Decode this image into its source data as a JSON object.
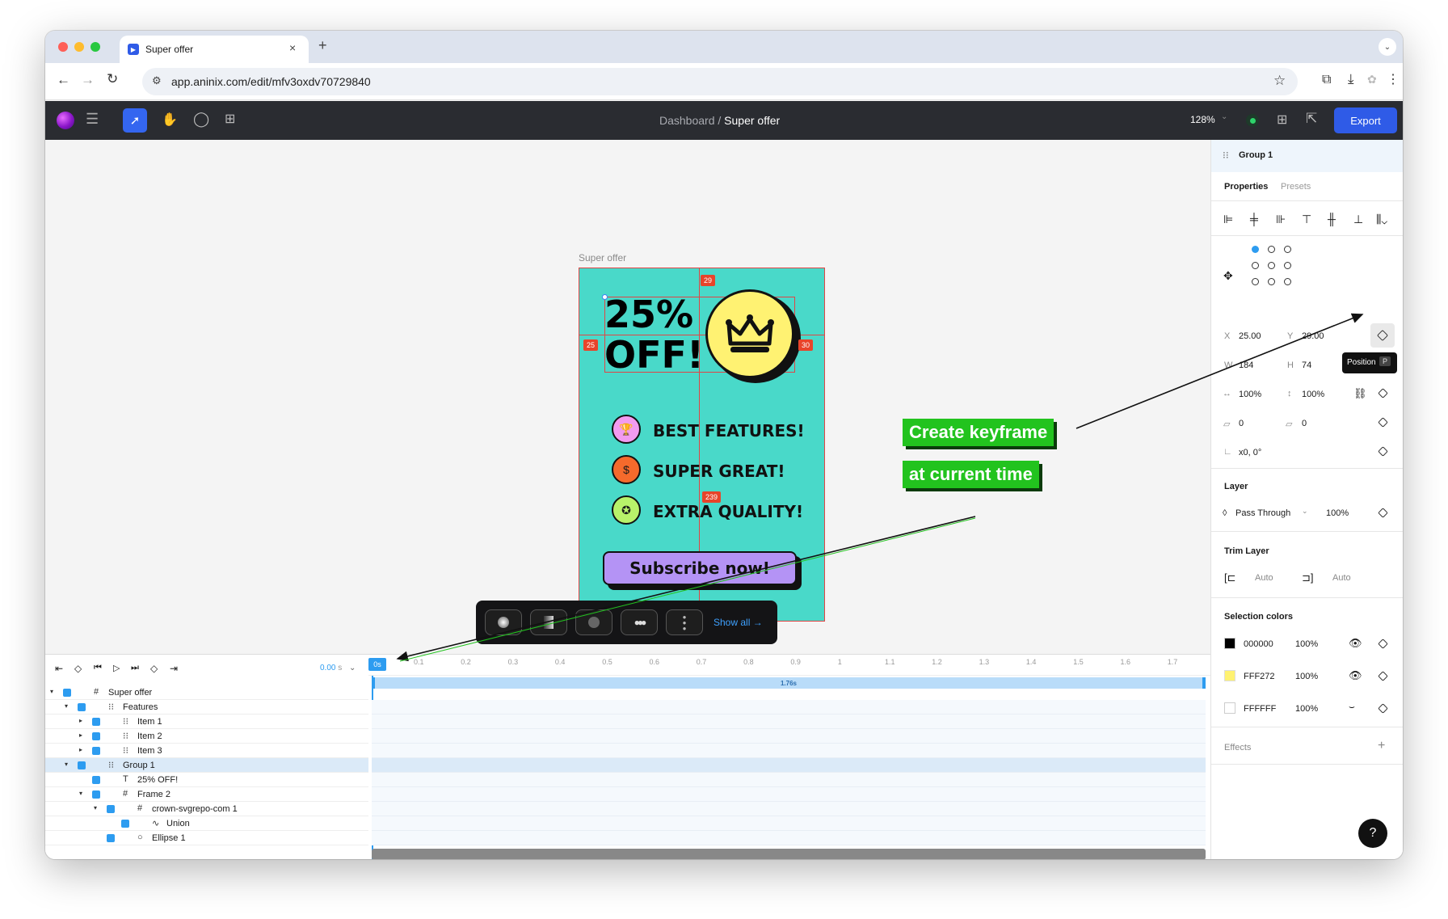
{
  "browser": {
    "tab_title": "Super offer",
    "url": "app.aninix.com/edit/mfv3oxdv70729840"
  },
  "header": {
    "breadcrumb_parent": "Dashboard",
    "breadcrumb_sep": "/",
    "breadcrumb_current": "Super offer",
    "zoom": "128%",
    "export_label": "Export",
    "accent": "#2f5be7"
  },
  "canvas": {
    "frame_label": "Super offer",
    "headline_1": "25%",
    "headline_2": "OFF!",
    "features": [
      "BEST FEATURES!",
      "SUPER GREAT!",
      "EXTRA QUALITY!"
    ],
    "cta": "Subscribe now!",
    "badges": {
      "top": "29",
      "left": "25",
      "right": "30",
      "bottom": "239"
    },
    "presets_show_all": "Show all →"
  },
  "annotations": {
    "line1": "Create keyframe",
    "line2": "at current time"
  },
  "panel": {
    "selection": "Group 1",
    "tab_properties": "Properties",
    "tab_presets": "Presets",
    "x_label": "X",
    "x_value": "25.00",
    "y_label": "Y",
    "y_value": "29.00",
    "w_label": "W",
    "w_value": "184",
    "h_label": "H",
    "h_value": "74",
    "tooltip": "Position",
    "tooltip_key": "P",
    "scale_x": "100%",
    "scale_y": "100%",
    "skew_1": "0",
    "skew_2": "0",
    "rotation": "x0, 0°",
    "layer_title": "Layer",
    "blend_mode": "Pass Through",
    "opacity": "100%",
    "trim_title": "Trim Layer",
    "trim_start": "Auto",
    "trim_end": "Auto",
    "selection_colors_title": "Selection colors",
    "colors": [
      {
        "hex": "000000",
        "swatch": "#000000",
        "opacity": "100%"
      },
      {
        "hex": "FFF272",
        "swatch": "#FFF272",
        "opacity": "100%"
      },
      {
        "hex": "FFFFFF",
        "swatch": "#FFFFFF",
        "opacity": "100%"
      }
    ],
    "effects_title": "Effects",
    "help": "?"
  },
  "timeline": {
    "time": "0.00",
    "time_unit": "s",
    "playhead": "0s",
    "duration_label": "1.76s",
    "ticks": [
      "0.1",
      "0.2",
      "0.3",
      "0.4",
      "0.5",
      "0.6",
      "0.7",
      "0.8",
      "0.9",
      "1",
      "1.1",
      "1.2",
      "1.3",
      "1.4",
      "1.5",
      "1.6",
      "1.7"
    ],
    "layers": [
      {
        "name": "Super offer",
        "icon": "frame-icon"
      },
      {
        "name": "Features",
        "icon": "group-icon"
      },
      {
        "name": "Item 1",
        "icon": "group-icon"
      },
      {
        "name": "Item 2",
        "icon": "group-icon"
      },
      {
        "name": "Item 3",
        "icon": "group-icon"
      },
      {
        "name": "Group 1",
        "icon": "group-icon"
      },
      {
        "name": "25% OFF!",
        "icon": "text-icon"
      },
      {
        "name": "Frame 2",
        "icon": "frame-icon"
      },
      {
        "name": "crown-svgrepo-com 1",
        "icon": "frame-icon"
      },
      {
        "name": "Union",
        "icon": "vector-icon"
      },
      {
        "name": "Ellipse 1",
        "icon": "ellipse-icon"
      }
    ]
  }
}
